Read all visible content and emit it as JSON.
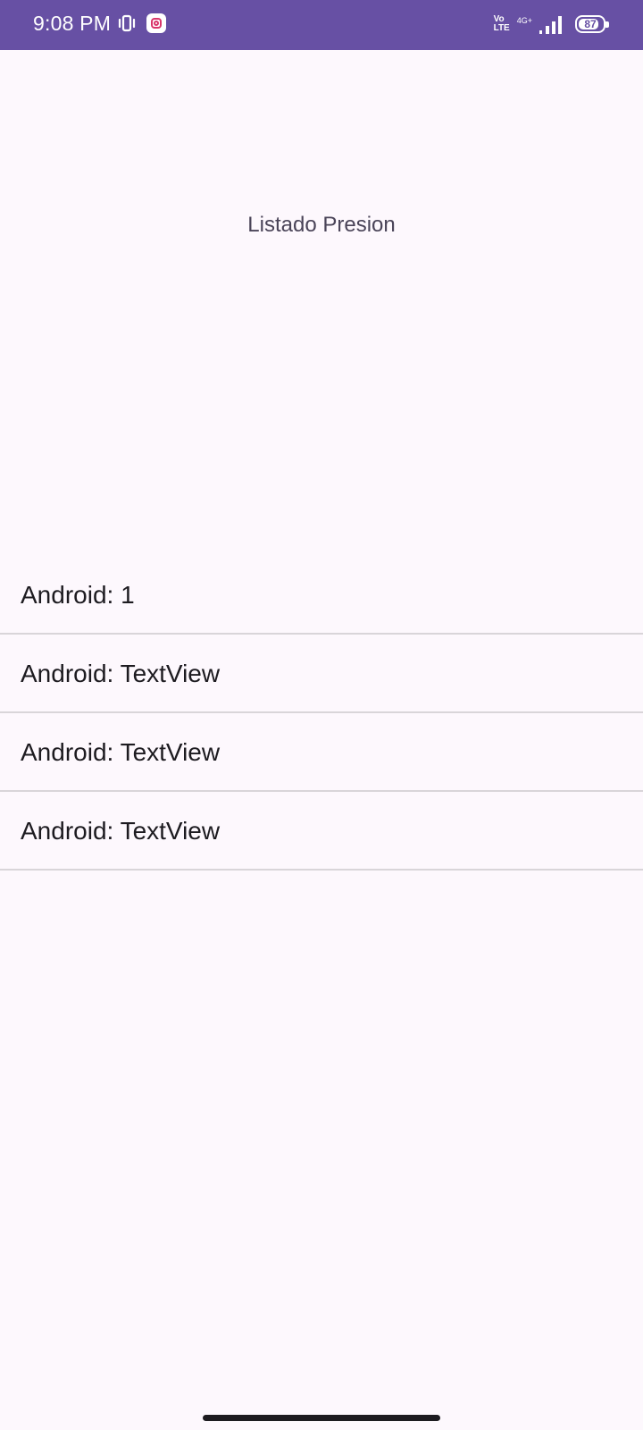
{
  "status_bar": {
    "time": "9:08 PM",
    "network_label_top": "Vo",
    "network_label_bottom": "LTE",
    "network_type": "4G+",
    "battery_level": "87",
    "icons": [
      "vibrate-icon",
      "instagram-icon",
      "signal-icon",
      "battery-icon"
    ],
    "background_color": "#6750a4"
  },
  "screen": {
    "title": "Listado Presion"
  },
  "list": {
    "items": [
      {
        "label": "Android: 1"
      },
      {
        "label": "Android: TextView"
      },
      {
        "label": "Android: TextView"
      },
      {
        "label": "Android: TextView"
      }
    ]
  }
}
